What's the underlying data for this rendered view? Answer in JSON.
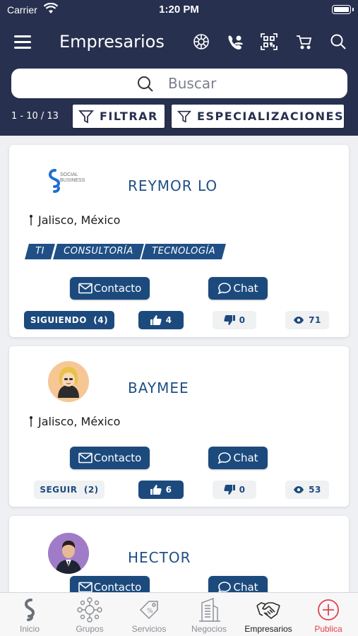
{
  "status_bar": {
    "carrier": "Carrier",
    "time": "1:20 PM"
  },
  "header": {
    "title": "Empresarios"
  },
  "search": {
    "placeholder": "Buscar"
  },
  "filters": {
    "pager": "1 - 10 / 13",
    "filter_label": "FILTRAR",
    "specializations_label": "ESPECIALIZACIONES"
  },
  "logo_text": {
    "line1": "SOCIAL",
    "line2": "BUSINESS"
  },
  "cards": [
    {
      "name": "REYMOR LO",
      "location": "Jalisco, México",
      "tags": [
        "TI",
        "CONSULTORÍA",
        "TECNOLOGÍA"
      ],
      "contact_label": "Contacto",
      "chat_label": "Chat",
      "follow_label": "SIGUIENDO  (4)",
      "likes": "4",
      "dislikes": "0",
      "views": "71"
    },
    {
      "name": "BAYMEE",
      "location": "Jalisco, México",
      "contact_label": "Contacto",
      "chat_label": "Chat",
      "follow_label": "SEGUIR  (2)",
      "likes": "6",
      "dislikes": "0",
      "views": "53"
    },
    {
      "name": "HECTOR",
      "contact_label": "Contacto",
      "chat_label": "Chat"
    }
  ],
  "tabbar": {
    "items": [
      {
        "label": "Inicio"
      },
      {
        "label": "Grupos"
      },
      {
        "label": "Servicios"
      },
      {
        "label": "Negocios"
      },
      {
        "label": "Empresarios"
      },
      {
        "label": "Publica"
      }
    ],
    "active": "Empresarios"
  },
  "colors": {
    "header_bg": "#27304e",
    "primary": "#1c4a7d",
    "accent_red": "#e0424d"
  }
}
